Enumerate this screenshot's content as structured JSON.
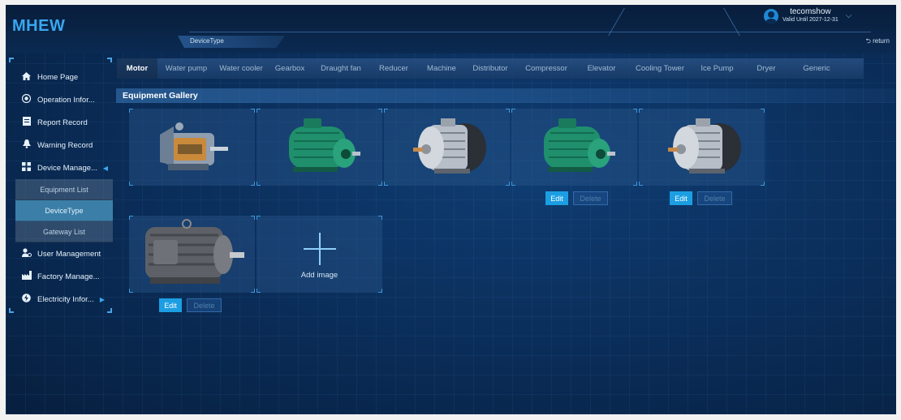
{
  "app": {
    "title": "MHEW"
  },
  "header": {
    "breadcrumb": "DeviceType",
    "return_label": "return"
  },
  "user": {
    "name": "tecomshow",
    "valid": "Valid Until 2027-12-31"
  },
  "sidebar": {
    "items": [
      {
        "label": "Home Page",
        "icon": "home-icon"
      },
      {
        "label": "Operation Infor...",
        "icon": "target-icon"
      },
      {
        "label": "Report Record",
        "icon": "report-icon"
      },
      {
        "label": "Warning Record",
        "icon": "bell-icon"
      },
      {
        "label": "Device Manage...",
        "icon": "grid-icon"
      },
      {
        "label": "User Management",
        "icon": "user-icon"
      },
      {
        "label": "Factory Manage...",
        "icon": "factory-icon"
      },
      {
        "label": "Electricity Infor...",
        "icon": "electricity-icon"
      }
    ],
    "subitems": [
      {
        "label": "Equipment List"
      },
      {
        "label": "DeviceType",
        "active": true
      },
      {
        "label": "Gateway List"
      }
    ]
  },
  "tabs": [
    "Motor",
    "Water pump",
    "Water cooler",
    "Gearbox",
    "Draught fan",
    "Reducer",
    "Machine",
    "Distributor",
    "Compressor",
    "Elevator",
    "Cooling Tower",
    "Ice Pump",
    "Dryer",
    "Generic"
  ],
  "active_tab": "Motor",
  "gallery": {
    "title": "Equipment Gallery",
    "edit_label": "Edit",
    "delete_label": "Delete",
    "add_label": "Add image",
    "images": [
      {
        "type": "cutaway-motor",
        "editable": false
      },
      {
        "type": "green-motor",
        "editable": false
      },
      {
        "type": "silver-motor",
        "editable": false
      },
      {
        "type": "green-motor",
        "editable": true
      },
      {
        "type": "silver-motor",
        "editable": true
      },
      {
        "type": "gray-motor",
        "editable": true
      }
    ]
  },
  "colors": {
    "accent": "#1c9ee2",
    "background": "#0a2a52",
    "logo": "#38a8f0"
  }
}
